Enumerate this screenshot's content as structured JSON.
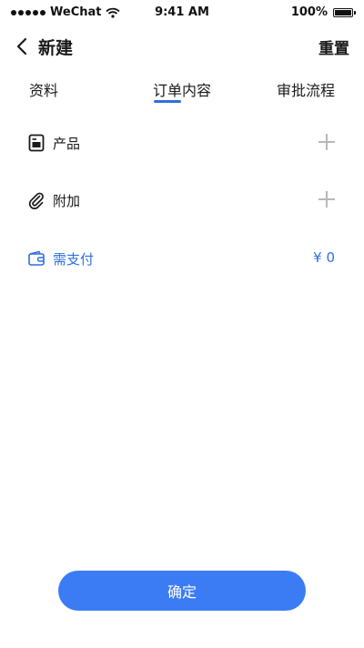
{
  "status_bar": {
    "carrier": "WeChat",
    "time": "9:41 AM",
    "battery": "100%"
  },
  "nav": {
    "title": "新建",
    "reset_label": "重置"
  },
  "tabs": [
    {
      "label": "资料"
    },
    {
      "label": "订单内容"
    },
    {
      "label": "审批流程"
    }
  ],
  "rows": {
    "products": {
      "label": "产品",
      "icon": "document-icon"
    },
    "addons": {
      "label": "附加",
      "icon": "paperclip-icon"
    },
    "payment": {
      "label": "需支付",
      "amount": "¥ 0",
      "icon": "wallet-icon"
    }
  },
  "confirm_label": "确定",
  "colors": {
    "accent": "#2f6fe0",
    "button": "#3b7cf4"
  }
}
